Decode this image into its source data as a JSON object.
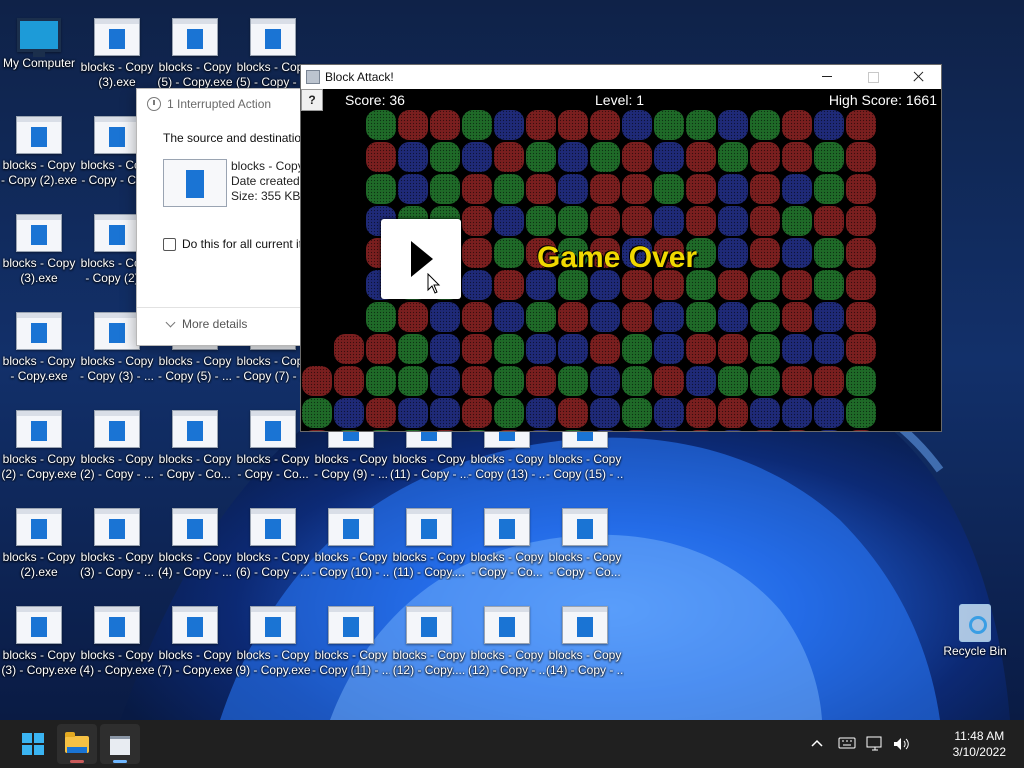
{
  "desktop": {
    "icons": [
      {
        "label": "My Computer",
        "kind": "computer"
      },
      {
        "label": "blocks - Copy\n(3).exe",
        "kind": "file"
      },
      {
        "label": "blocks - Copy\n(5) - Copy.exe",
        "kind": "file"
      },
      {
        "label": "blocks - Copy\n(5) - Copy - ...",
        "kind": "file"
      },
      {
        "label": "blocks - Copy\n- Copy (2).exe",
        "kind": "file"
      },
      {
        "label": "blocks - Copy\n- Copy - Co...",
        "kind": "file"
      },
      {
        "label": "blocks - Copy\n(3).exe",
        "kind": "file"
      },
      {
        "label": "blocks - Copy\n- Copy (2)...",
        "kind": "file"
      },
      {
        "label": "blocks - Copy\n- Copy.exe",
        "kind": "file"
      },
      {
        "label": "blocks - Copy\n- Copy (3) - ...",
        "kind": "file"
      },
      {
        "label": "blocks - Copy\n- Copy (5) - ...",
        "kind": "file"
      },
      {
        "label": "blocks - Copy\n- Copy (7) - ...",
        "kind": "file"
      },
      {
        "label": "blocks - Copy\n(2) - Copy.exe",
        "kind": "file"
      },
      {
        "label": "blocks - Copy\n(2) - Copy - ...",
        "kind": "file"
      },
      {
        "label": "blocks - Copy\n- Copy - Co...",
        "kind": "file"
      },
      {
        "label": "blocks - Copy\n- Copy - Co...",
        "kind": "file"
      },
      {
        "label": "blocks - Copy\n- Copy (9) - ...",
        "kind": "file"
      },
      {
        "label": "blocks - Copy\n(11) - Copy - ...",
        "kind": "file"
      },
      {
        "label": "blocks - Copy\n- Copy (13) - ...",
        "kind": "file"
      },
      {
        "label": "blocks - Copy\n- Copy (15) - ...",
        "kind": "file"
      },
      {
        "label": "blocks - Copy\n(2).exe",
        "kind": "file"
      },
      {
        "label": "blocks - Copy\n(3) - Copy - ...",
        "kind": "file"
      },
      {
        "label": "blocks - Copy\n(4) - Copy - ...",
        "kind": "file"
      },
      {
        "label": "blocks - Copy\n(6) - Copy - ...",
        "kind": "file"
      },
      {
        "label": "blocks - Copy\n- Copy (10) - ...",
        "kind": "file"
      },
      {
        "label": "blocks - Copy\n(11) - Copy....",
        "kind": "file"
      },
      {
        "label": "blocks - Copy\n- Copy - Co...",
        "kind": "file"
      },
      {
        "label": "blocks - Copy\n- Copy - Co...",
        "kind": "file"
      },
      {
        "label": "blocks - Copy\n(3) - Copy.exe",
        "kind": "file"
      },
      {
        "label": "blocks - Copy\n(4) - Copy.exe",
        "kind": "file"
      },
      {
        "label": "blocks - Copy\n(7) - Copy.exe",
        "kind": "file"
      },
      {
        "label": "blocks - Copy\n(9) - Copy.exe",
        "kind": "file"
      },
      {
        "label": "blocks - Copy\n- Copy (11) - ...",
        "kind": "file"
      },
      {
        "label": "blocks - Copy\n(12) - Copy....",
        "kind": "file"
      },
      {
        "label": "blocks - Copy\n(12) - Copy - ...",
        "kind": "file"
      },
      {
        "label": "blocks - Copy\n(14) - Copy - ...",
        "kind": "file"
      },
      {
        "label": "Recycle Bin",
        "kind": "bin"
      }
    ]
  },
  "dialog": {
    "title": "1 Interrupted Action",
    "message": "The source and destination",
    "file_name": "blocks - Copy",
    "date_created": "Date created:",
    "size": "Size: 355 KB",
    "checkbox_label": "Do this for all current it",
    "more_details": "More details"
  },
  "game_window": {
    "title": "Block Attack!",
    "help_label": "?",
    "score": "Score: 36",
    "level": "Level: 1",
    "high_score": "High Score: 1661",
    "game_over": "Game Over",
    "block_colors": {
      "red": "#7a1f1f",
      "green": "#1f6a28",
      "blue": "#1f2a78"
    },
    "board": [
      "..gRRgbrRRbggbgrbr",
      "..rbgbRgbgrbrgrRgr",
      "..gbgRgrbRrgRbrbgR",
      "..bggRbggrRbrbRgrR",
      "..rRbrgRgRbrgbrbgR",
      "..bggbrbgbRRgRgrgR",
      "..grbRbgrbrbgbgRbr",
      ".rrgbrgbbrgbrRgbbr",
      "rrggbrgrgbgRbggrRg",
      "gbrbbrgbrbgbRrbbbg",
      "rgggrgrbgbRbRbRrbR"
    ]
  },
  "taskbar": {
    "time": "11:48 AM",
    "date": "3/10/2022",
    "accent": "#3ab4f2"
  }
}
